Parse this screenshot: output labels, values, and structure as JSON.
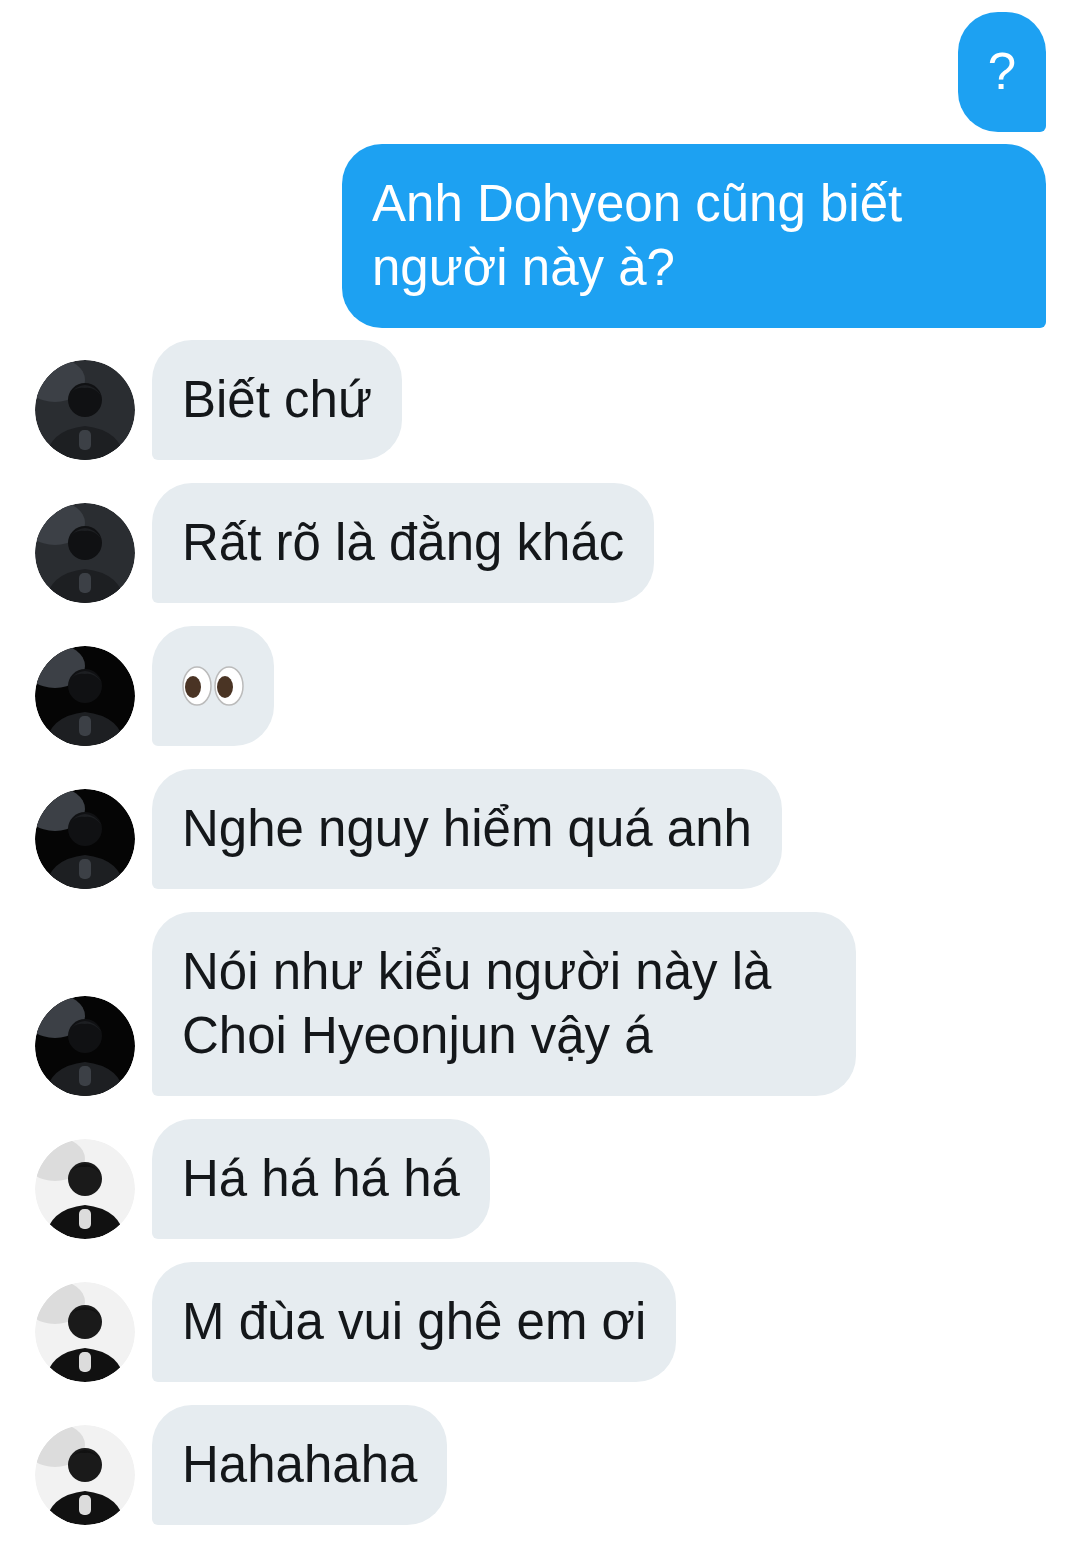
{
  "messages": [
    {
      "outgoing": true,
      "kind": "text",
      "text": "?"
    },
    {
      "outgoing": true,
      "kind": "text",
      "text": "Anh Dohyeon cũng biết người này à?"
    },
    {
      "outgoing": false,
      "kind": "text",
      "text": "Biết chứ"
    },
    {
      "outgoing": false,
      "kind": "text",
      "text": "Rất rõ là đằng khác"
    },
    {
      "outgoing": false,
      "kind": "eyes"
    },
    {
      "outgoing": false,
      "kind": "text",
      "text": "Nghe nguy hiểm quá anh"
    },
    {
      "outgoing": false,
      "kind": "text",
      "text": "Nói như kiểu người này là Choi Hyeonjun vậy á"
    },
    {
      "outgoing": false,
      "kind": "text",
      "text": "Há há há há"
    },
    {
      "outgoing": false,
      "kind": "text",
      "text": "M đùa vui ghê em ơi"
    },
    {
      "outgoing": false,
      "kind": "text",
      "text": "Hahahaha"
    }
  ]
}
